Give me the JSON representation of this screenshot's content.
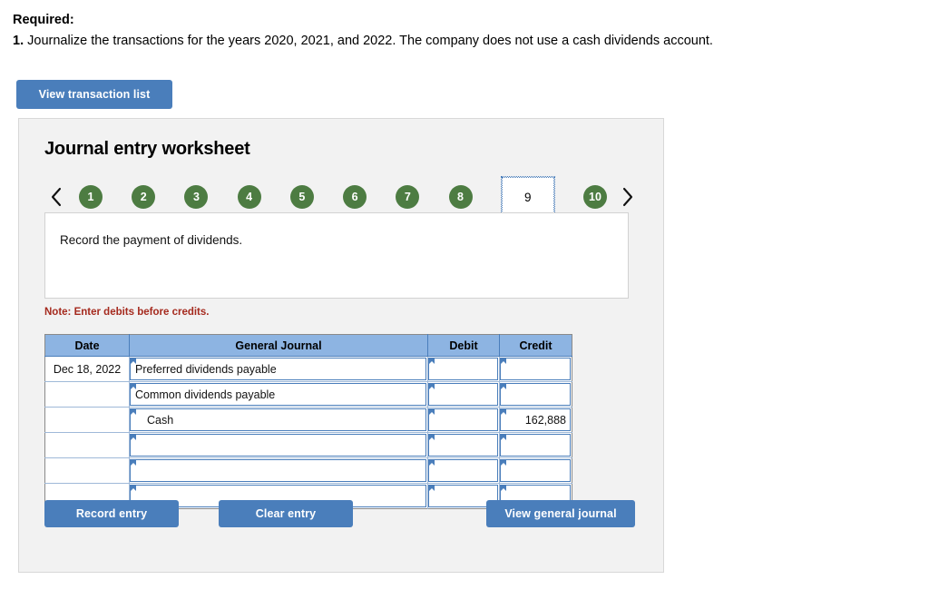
{
  "required": {
    "heading": "Required:",
    "item_number": "1.",
    "item_text": "Journalize the transactions for the years 2020, 2021, and 2022. The company does not use a cash dividends account."
  },
  "toolbar": {
    "view_transaction_list": "View transaction list"
  },
  "worksheet": {
    "title": "Journal entry worksheet",
    "prompt": "Record the payment of dividends.",
    "note": "Note: Enter debits before credits.",
    "pager": {
      "prev_icon": "chevron-left-icon",
      "next_icon": "chevron-right-icon",
      "active": "9",
      "pages": [
        "1",
        "2",
        "3",
        "4",
        "5",
        "6",
        "7",
        "8",
        "9",
        "10"
      ]
    },
    "table": {
      "headers": [
        "Date",
        "General Journal",
        "Debit",
        "Credit"
      ],
      "rows": [
        {
          "date": "Dec 18, 2022",
          "account": "Preferred dividends payable",
          "indent": false,
          "debit": "",
          "credit": ""
        },
        {
          "date": "",
          "account": "Common dividends payable",
          "indent": false,
          "debit": "",
          "credit": ""
        },
        {
          "date": "",
          "account": "Cash",
          "indent": true,
          "debit": "",
          "credit": "162,888"
        },
        {
          "date": "",
          "account": "",
          "indent": false,
          "debit": "",
          "credit": ""
        },
        {
          "date": "",
          "account": "",
          "indent": false,
          "debit": "",
          "credit": ""
        },
        {
          "date": "",
          "account": "",
          "indent": false,
          "debit": "",
          "credit": ""
        }
      ]
    },
    "footer": {
      "record_entry": "Record entry",
      "clear_entry": "Clear entry",
      "view_general_journal": "View general journal"
    }
  },
  "colors": {
    "button_blue": "#4a7ebb",
    "pager_green": "#4d7c42",
    "header_blue": "#8db4e2",
    "note_red": "#a52a1e",
    "panel_gray": "#f2f2f2"
  }
}
